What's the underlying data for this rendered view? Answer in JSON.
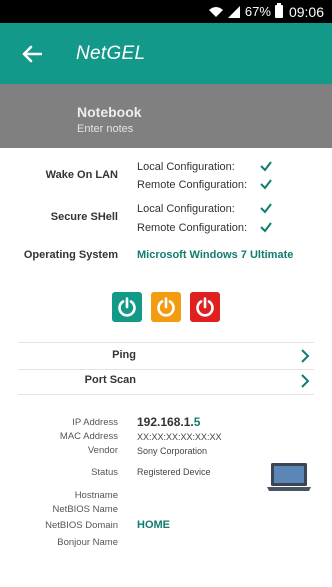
{
  "status_bar": {
    "battery": "67%",
    "time": "09:06"
  },
  "app_bar": {
    "title": "NetGEL"
  },
  "notebook": {
    "title": "Notebook",
    "subtitle": "Enter notes"
  },
  "wake_on_lan": {
    "label": "Wake On LAN",
    "local": "Local Configuration:",
    "remote": "Remote Configuration:"
  },
  "secure_shell": {
    "label": "Secure SHell",
    "local": "Local Configuration:",
    "remote": "Remote Configuration:"
  },
  "os": {
    "label": "Operating System",
    "value": "Microsoft Windows 7 Ultimate"
  },
  "power_buttons": {
    "colors": [
      "#129987",
      "#f39c12",
      "#e0201f"
    ]
  },
  "actions": {
    "ping": "Ping",
    "port_scan": "Port Scan"
  },
  "device": {
    "ip_label": "IP Address",
    "ip_main": "192.168.1.",
    "ip_last": "5",
    "mac_label": "MAC Address",
    "mac_value": "XX:XX:XX:XX:XX:XX",
    "vendor_label": "Vendor",
    "vendor_value": "Sony Corporation",
    "status_label": "Status",
    "status_value": "Registered Device",
    "hostname_label": "Hostname",
    "netbios_name_label": "NetBIOS Name",
    "netbios_domain_label": "NetBIOS Domain",
    "netbios_domain_value": "HOME",
    "bonjour_label": "Bonjour Name"
  }
}
